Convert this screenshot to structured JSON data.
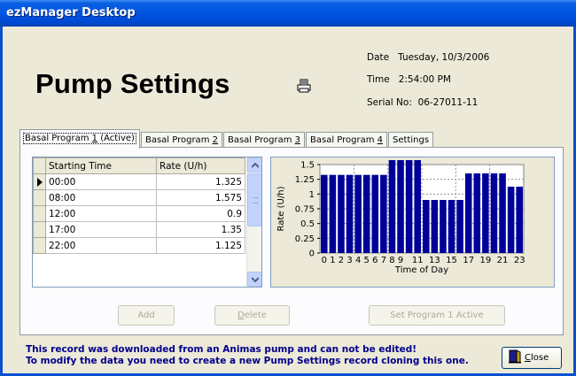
{
  "window": {
    "title": "ezManager Desktop"
  },
  "header": {
    "page_title": "Pump Settings",
    "print_icon": "printer-icon",
    "date_label": "Date",
    "date_value": "Tuesday, 10/3/2006",
    "time_label": "Time",
    "time_value": "2:54:00 PM",
    "serial_label": "Serial No:",
    "serial_value": "06-27011-11"
  },
  "tabs": [
    {
      "pre": "Basal Program ",
      "key": "1",
      "post": " (Active)",
      "active": true
    },
    {
      "pre": "Basal Program ",
      "key": "2",
      "post": "",
      "active": false
    },
    {
      "pre": "Basal Program ",
      "key": "3",
      "post": "",
      "active": false
    },
    {
      "pre": "Basal Program ",
      "key": "4",
      "post": "",
      "active": false
    },
    {
      "pre": "Settings",
      "key": "",
      "post": "",
      "active": false
    }
  ],
  "grid": {
    "columns": [
      "Starting Time",
      "Rate (U/h)"
    ],
    "rows": [
      {
        "time": "00:00",
        "rate": "1.325",
        "current": true
      },
      {
        "time": "08:00",
        "rate": "1.575",
        "current": false
      },
      {
        "time": "12:00",
        "rate": "0.9",
        "current": false
      },
      {
        "time": "17:00",
        "rate": "1.35",
        "current": false
      },
      {
        "time": "22:00",
        "rate": "1.125",
        "current": false
      }
    ]
  },
  "chart_data": {
    "type": "bar",
    "xlabel": "Time of Day",
    "ylabel": "Rate (U/h)",
    "ylim": [
      0,
      1.5
    ],
    "yticks": [
      "0",
      "0.25",
      "0.5",
      "0.75",
      "1",
      "1.25",
      "1.5"
    ],
    "xtick_labels": [
      "0",
      "1",
      "2",
      "3",
      "4",
      "5",
      "6",
      "7",
      "8",
      "9",
      "11",
      "13",
      "15",
      "17",
      "19",
      "21",
      "23"
    ],
    "xtick_positions": [
      0,
      1,
      2,
      3,
      4,
      5,
      6,
      7,
      8,
      9,
      11,
      13,
      15,
      17,
      19,
      21,
      23
    ],
    "categories": [
      0,
      1,
      2,
      3,
      4,
      5,
      6,
      7,
      8,
      9,
      10,
      11,
      12,
      13,
      14,
      15,
      16,
      17,
      18,
      19,
      20,
      21,
      22,
      23
    ],
    "values": [
      1.325,
      1.325,
      1.325,
      1.325,
      1.325,
      1.325,
      1.325,
      1.325,
      1.575,
      1.575,
      1.575,
      1.575,
      0.9,
      0.9,
      0.9,
      0.9,
      0.9,
      1.35,
      1.35,
      1.35,
      1.35,
      1.35,
      1.125,
      1.125
    ],
    "grid": true,
    "bar_color": "#000099"
  },
  "buttons": {
    "add": "Add",
    "delete_pre": "",
    "delete_key": "D",
    "delete_post": "elete",
    "set_active": "Set Program 1 Active",
    "close_key": "C",
    "close_post": "lose",
    "close_icon": "exit-door-icon"
  },
  "notice": {
    "line1": "This record was downloaded from an Animas pump and can not be edited!",
    "line2": "To modify the data you need to create a new Pump Settings record cloning this one."
  }
}
